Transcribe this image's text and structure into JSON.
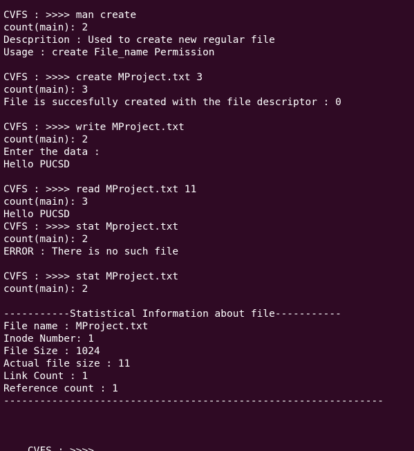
{
  "terminal": {
    "lines": [
      "CVFS : >>>> man create",
      "count(main): 2",
      "Descprition : Used to create new regular file",
      "Usage : create File_name Permission",
      "",
      "CVFS : >>>> create MProject.txt 3",
      "count(main): 3",
      "File is succesfully created with the file descriptor : 0",
      "",
      "CVFS : >>>> write MProject.txt",
      "count(main): 2",
      "Enter the data :",
      "Hello PUCSD",
      "",
      "CVFS : >>>> read MProject.txt 11",
      "count(main): 3",
      "Hello PUCSD",
      "CVFS : >>>> stat Mproject.txt",
      "count(main): 2",
      "ERROR : There is no such file",
      "",
      "CVFS : >>>> stat MProject.txt",
      "count(main): 2",
      "",
      "-----------Statistical Information about file-----------",
      "File name : MProject.txt",
      "Inode Number: 1",
      "File Size : 1024",
      "Actual file size : 11",
      "Link Count : 1",
      "Reference count : 1",
      "---------------------------------------------------------------"
    ],
    "prompt": "CVFS : >>>>"
  }
}
